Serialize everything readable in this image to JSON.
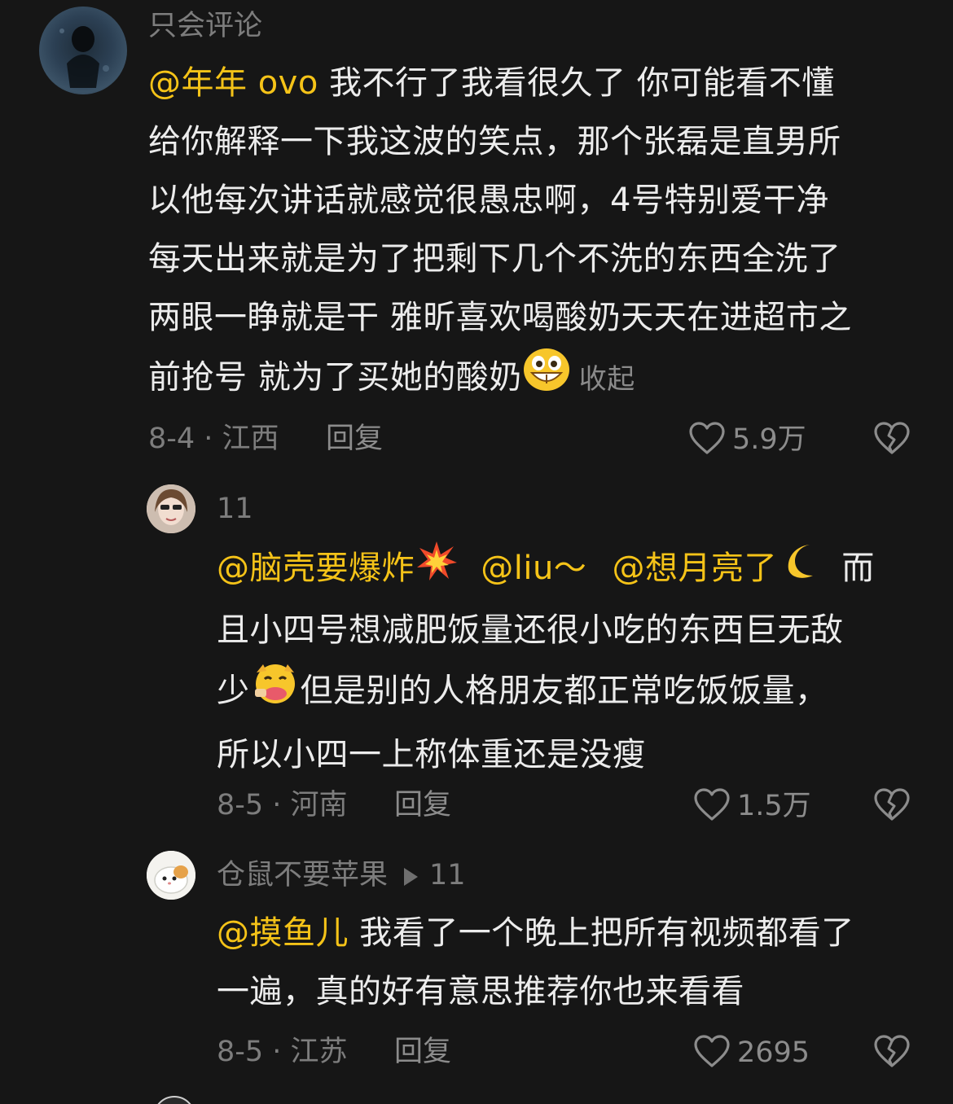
{
  "comments": [
    {
      "username": "只会评论",
      "mention": "@年年 ovo",
      "lines": [
        "我不行了我看很久了 你可能看不懂",
        "给你解释一下我这波的笑点，那个张磊是直男所",
        "以他每次讲话就感觉很愚忠啊，4号特别爱干净",
        "每天出来就是为了把剩下几个不洗的东西全洗了",
        "两眼一睁就是干 雅昕喜欢喝酸奶天天在进超市之",
        "前抢号 就为了买她的酸奶"
      ],
      "collapse_label": "收起",
      "date_location": "8-4 · 江西",
      "reply_label": "回复",
      "likes": "5.9万"
    },
    {
      "username": "11",
      "mentions": [
        "@脑壳要爆炸",
        "@liu～",
        "@想月亮了"
      ],
      "line1_tail": "而",
      "line2": "且小四号想减肥饭量还很小吃的东西巨无敌",
      "line3_head": "少",
      "line3_tail": "但是别的人格朋友都正常吃饭饭量，",
      "line4": "所以小四一上称体重还是没瘦",
      "date_location": "8-5 · 河南",
      "reply_label": "回复",
      "likes": "1.5万"
    },
    {
      "username": "仓鼠不要苹果",
      "reply_to": "11",
      "mention": "@摸鱼儿",
      "line1": "我看了一个晚上把所有视频都看了",
      "line2": "一遍，真的好有意思推荐你也来看看",
      "date_location": "8-5 · 江苏",
      "reply_label": "回复",
      "likes": "2695"
    }
  ],
  "icons": {
    "like": "heart-outline-icon",
    "dislike": "broken-heart-icon",
    "reply_arrow": "play-triangle-icon"
  },
  "colors": {
    "background": "#161616",
    "mention": "#f5c318",
    "text": "#ececec",
    "muted": "#7d7d7d"
  }
}
